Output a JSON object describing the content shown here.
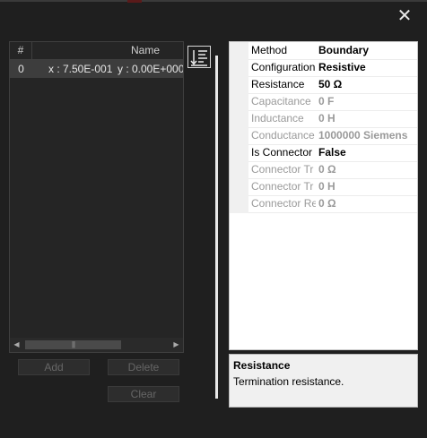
{
  "window": {
    "close_glyph": "✕"
  },
  "list": {
    "columns": [
      "#",
      "Name"
    ],
    "rows": [
      {
        "index": "0",
        "x": "x : 7.50E-001",
        "y": "y : 0.00E+000"
      }
    ],
    "scroll_left_glyph": "◀",
    "scroll_right_glyph": "▶",
    "scroll_grip_glyph": "|||"
  },
  "buttons": {
    "add": "Add",
    "delete": "Delete",
    "clear": "Clear"
  },
  "sort_toggle_icon": "sort-list-icon",
  "properties": [
    {
      "name": "Method",
      "value": "Boundary",
      "enabled": true
    },
    {
      "name": "Configuration",
      "value": "Resistive",
      "enabled": true
    },
    {
      "name": "Resistance",
      "value": "50 Ω",
      "enabled": true
    },
    {
      "name": "Capacitance",
      "value": "0 F",
      "enabled": false
    },
    {
      "name": "Inductance",
      "value": "0 H",
      "enabled": false
    },
    {
      "name": "Conductance",
      "value": "1000000 Siemens",
      "enabled": false
    },
    {
      "name": "Is Connector",
      "value": "False",
      "enabled": true
    },
    {
      "name": "Connector Tr",
      "value": "0 Ω",
      "enabled": false
    },
    {
      "name": "Connector Tr",
      "value": "0 H",
      "enabled": false
    },
    {
      "name": "Connector Re",
      "value": "0 Ω",
      "enabled": false
    }
  ],
  "description": {
    "title": "Resistance",
    "text": "Termination resistance."
  },
  "colors": {
    "background": "#1f1f1f",
    "selected_row": "#3d3d3d",
    "grid_bg": "#ffffff",
    "disabled_text": "#9a9a9a"
  }
}
